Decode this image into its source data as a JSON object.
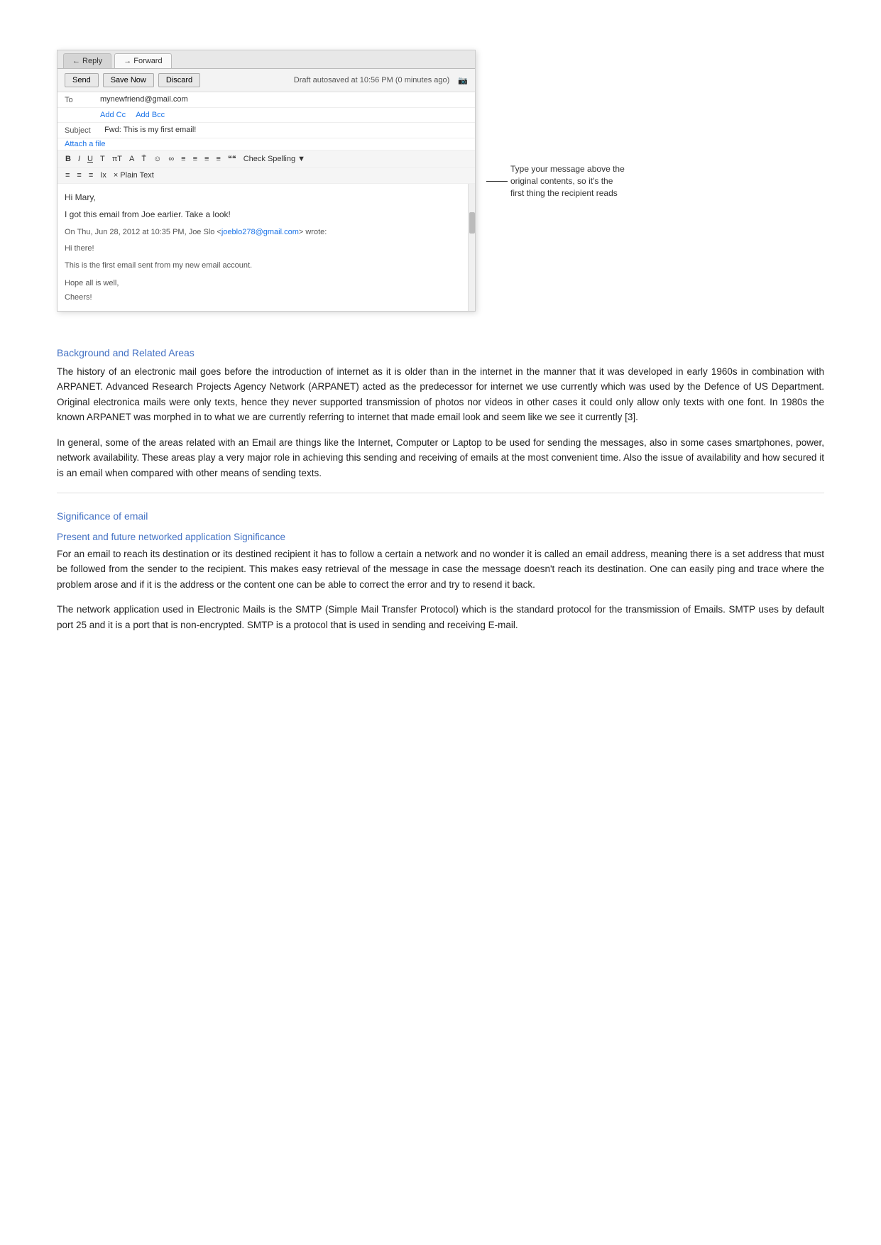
{
  "email": {
    "tabs": [
      {
        "label": "← Reply",
        "active": false
      },
      {
        "label": "→ Forward",
        "active": true
      }
    ],
    "toolbar": {
      "send_label": "Send",
      "save_now_label": "Save Now",
      "discard_label": "Discard",
      "draft_note": "Draft autosaved at 10:56 PM (0 minutes ago)"
    },
    "to": {
      "label": "To",
      "value": "mynewfriend@gmail.com"
    },
    "cc_bcc": {
      "add_cc": "Add Cc",
      "add_bcc": "Add Bcc"
    },
    "subject": {
      "label": "Subject",
      "value": "Fwd: This is my first email!"
    },
    "attach": "Attach a file",
    "format_buttons": [
      "B",
      "I",
      "U",
      "T",
      "πT",
      "A",
      "T",
      "☺",
      "∞",
      "≡",
      "≡",
      "≡",
      "≡",
      "❝❝",
      "Check Spelling ▼"
    ],
    "format_buttons2": [
      "≡",
      "≡",
      "≡",
      "Ix",
      "× Plain Text"
    ],
    "body_greeting": "Hi Mary,",
    "body_line1": "I got this email from Joe earlier. Take a look!",
    "body_quoted_header": "On Thu, Jun 28, 2012 at 10:35 PM, Joe Slo <joeblo278@gmail.com> wrote:",
    "body_quoted_1": "Hi there!",
    "body_quoted_2": "This is the first email sent from my new email account.",
    "body_quoted_3": "Hope all is well,",
    "body_quoted_4": "Cheers!"
  },
  "annotation": {
    "text": "Type your message above the original contents, so it's the first thing the recipient reads"
  },
  "sections": [
    {
      "id": "background",
      "heading": "Background and Related Areas",
      "paragraphs": [
        "The history of an electronic mail goes before the introduction of internet as it is older than in the internet in the manner that it was developed in early 1960s in combination with ARPANET. Advanced Research Projects Agency Network (ARPANET) acted as the predecessor for internet we use currently which was used by the Defence of US Department. Original electronica mails were only texts, hence they never supported transmission of photos nor videos in other cases it could only allow only texts with one font. In 1980s the known ARPANET was morphed in to what we are currently referring to internet that made email look and seem like we see it currently [3].",
        "In general, some of the areas related with an Email are things like the Internet, Computer or Laptop to be used for sending the messages, also in some cases smartphones, power, network availability. These areas play a very major role in achieving this sending and receiving of emails at the most convenient time. Also the issue of availability and how secured it is an email when compared with other means of sending texts."
      ]
    },
    {
      "id": "significance",
      "heading": "Significance of email",
      "sub_sections": [
        {
          "id": "networked",
          "sub_heading": "Present and future networked application Significance",
          "paragraphs": [
            "For an email to reach its destination or its destined recipient it has to follow a certain a network and no wonder it is called an email address, meaning there is a set address that must be followed from the sender to the recipient. This makes easy retrieval of the message in case the message doesn't reach its destination. One can easily ping and trace where the problem arose and if it is the address or the content one can be able to correct the error and try to resend it back.",
            "The network application used in Electronic Mails is the SMTP (Simple Mail Transfer Protocol) which is the standard protocol for the transmission of Emails. SMTP uses by default port 25 and it is a port that is non-encrypted. SMTP is a protocol that is used in sending and receiving E-mail."
          ]
        }
      ]
    }
  ]
}
